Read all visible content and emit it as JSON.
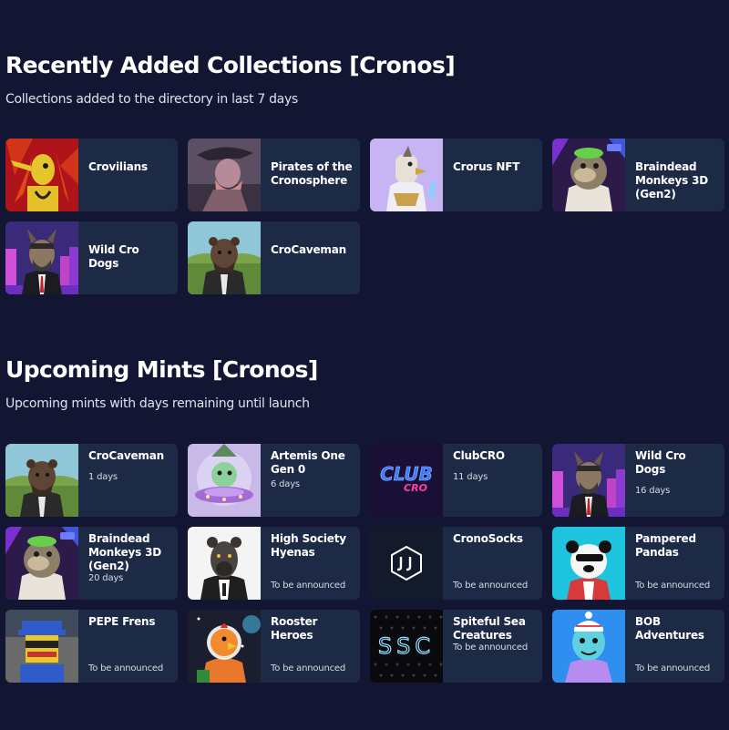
{
  "recent": {
    "title": "Recently Added Collections [Cronos]",
    "subtitle": "Collections added to the directory in last 7 days",
    "items": [
      {
        "name": "Crovilians"
      },
      {
        "name": "Pirates of the Cronosphere"
      },
      {
        "name": "Crorus NFT"
      },
      {
        "name": "Braindead Monkeys 3D (Gen2)"
      },
      {
        "name": "Wild Cro Dogs"
      },
      {
        "name": "CroCaveman"
      }
    ]
  },
  "upcoming": {
    "title": "Upcoming Mints [Cronos]",
    "subtitle": "Upcoming mints with days remaining until launch",
    "items": [
      {
        "name": "CroCaveman",
        "days": "1 days"
      },
      {
        "name": "Artemis One Gen 0",
        "days": "6 days"
      },
      {
        "name": "ClubCRO",
        "days": "11 days"
      },
      {
        "name": "Wild Cro Dogs",
        "days": "16 days"
      },
      {
        "name": "Braindead Monkeys 3D (Gen2)",
        "days": "20 days"
      },
      {
        "name": "High Society Hyenas",
        "days": "To be announced"
      },
      {
        "name": "CronoSocks",
        "days": "To be announced"
      },
      {
        "name": "Pampered Pandas",
        "days": "To be announced"
      },
      {
        "name": "PEPE Frens",
        "days": "To be announced"
      },
      {
        "name": "Rooster Heroes",
        "days": "To be announced"
      },
      {
        "name": "Spiteful Sea Creatures",
        "days": "To be announced"
      },
      {
        "name": "BOB Adventures",
        "days": "To be announced"
      }
    ],
    "clubcro_logo": {
      "line1": "CLUB",
      "line2": "CRO"
    },
    "ssc_logo": "SSC"
  },
  "colors": {
    "background": "#121632",
    "card": "#1d2a45"
  }
}
